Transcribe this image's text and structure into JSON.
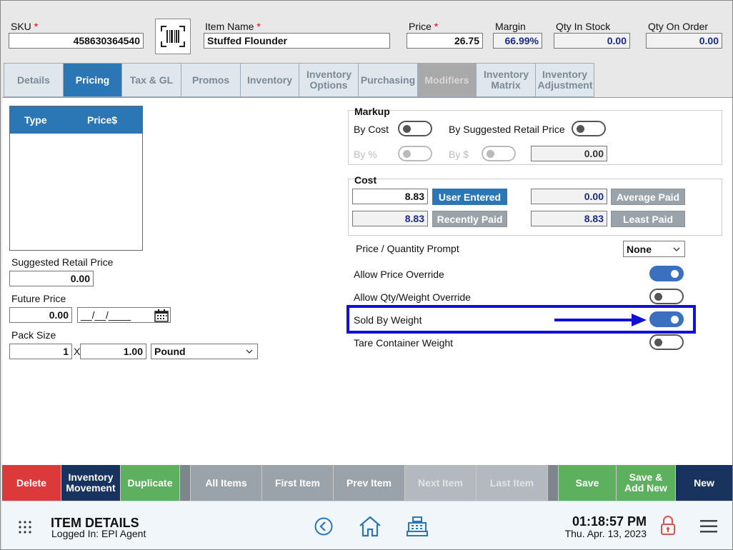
{
  "header": {
    "sku_label": "SKU",
    "sku_value": "458630364540",
    "item_name_label": "Item Name",
    "item_name_value": "Stuffed Flounder",
    "price_label": "Price",
    "price_value": "26.75",
    "margin_label": "Margin",
    "margin_value": "66.99%",
    "qty_in_stock_label": "Qty In Stock",
    "qty_in_stock_value": "0.00",
    "qty_on_order_label": "Qty On Order",
    "qty_on_order_value": "0.00",
    "required_mark": "*"
  },
  "tabs": [
    {
      "label": "Details",
      "state": "normal"
    },
    {
      "label": "Pricing",
      "state": "active"
    },
    {
      "label": "Tax & GL",
      "state": "normal"
    },
    {
      "label": "Promos",
      "state": "normal"
    },
    {
      "label": "Inventory",
      "state": "normal"
    },
    {
      "label": "Inventory Options",
      "state": "normal"
    },
    {
      "label": "Purchasing",
      "state": "normal"
    },
    {
      "label": "Modifiers",
      "state": "disabled"
    },
    {
      "label": "Inventory Matrix",
      "state": "normal"
    },
    {
      "label": "Inventory Adjustment",
      "state": "normal"
    }
  ],
  "price_list": {
    "col_type": "Type",
    "col_price": "Price$"
  },
  "left": {
    "suggested_retail_label": "Suggested Retail Price",
    "suggested_retail_value": "0.00",
    "future_price_label": "Future Price",
    "future_price_value": "0.00",
    "future_date_value": "__/__/____",
    "pack_size_label": "Pack Size",
    "pack_qty": "1",
    "pack_x": "X",
    "pack_amount": "1.00",
    "pack_unit": "Pound"
  },
  "markup": {
    "title": "Markup",
    "by_cost_label": "By Cost",
    "by_srp_label": "By Suggested Retail Price",
    "by_pct_label": "By %",
    "by_dollar_label": "By $",
    "value": "0.00"
  },
  "cost": {
    "title": "Cost",
    "user_entered_value": "8.83",
    "user_entered_label": "User Entered",
    "average_paid_value": "0.00",
    "average_paid_label": "Average Paid",
    "recently_paid_value": "8.83",
    "recently_paid_label": "Recently Paid",
    "least_paid_value": "8.83",
    "least_paid_label": "Least Paid"
  },
  "options": {
    "price_qty_prompt_label": "Price / Quantity Prompt",
    "price_qty_prompt_value": "None",
    "allow_price_override_label": "Allow Price Override",
    "allow_price_override": true,
    "allow_qty_weight_override_label": "Allow Qty/Weight Override",
    "allow_qty_weight_override": false,
    "sold_by_weight_label": "Sold By Weight",
    "sold_by_weight": true,
    "tare_container_weight_label": "Tare Container Weight",
    "tare_container_weight": false
  },
  "actions": [
    {
      "label": "Delete",
      "color": "#dc3a3a"
    },
    {
      "label": "Inventory Movement",
      "color": "#17335e"
    },
    {
      "label": "Duplicate",
      "color": "#5db05d"
    },
    {
      "label": "All Items",
      "color": "#9aa3aa"
    },
    {
      "label": "First Item",
      "color": "#9aa3aa"
    },
    {
      "label": "Prev Item",
      "color": "#9aa3aa"
    },
    {
      "label": "Next Item",
      "color": "#b3b9be"
    },
    {
      "label": "Last Item",
      "color": "#b3b9be"
    },
    {
      "label": "Save",
      "color": "#5db05d"
    },
    {
      "label": "Save & Add New",
      "color": "#5db05d"
    },
    {
      "label": "New",
      "color": "#17335e"
    }
  ],
  "footer": {
    "title": "ITEM DETAILS",
    "logged_in": "Logged In:  EPI Agent",
    "time": "01:18:57 PM",
    "date": "Thu. Apr. 13, 2023"
  },
  "colors": {
    "accent": "#2b77b5",
    "highlight": "#1010d8",
    "toggle_on": "#3b6fbf"
  }
}
